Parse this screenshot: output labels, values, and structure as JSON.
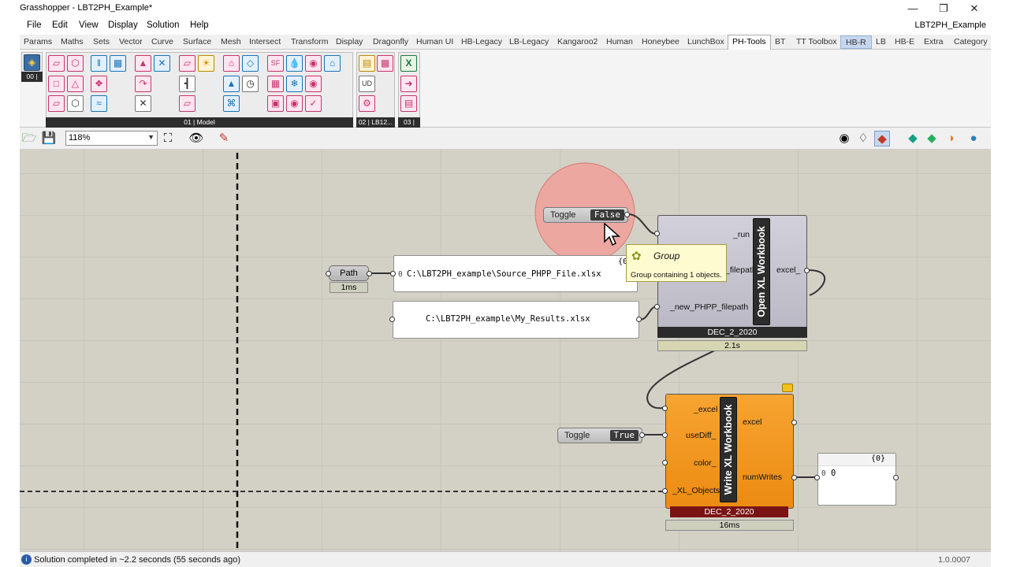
{
  "window": {
    "title": "Grasshopper - LBT2PH_Example*",
    "document_name": "LBT2PH_Example"
  },
  "menu": [
    "File",
    "Edit",
    "View",
    "Display",
    "Solution",
    "Help"
  ],
  "tabs": [
    "Params",
    "Maths",
    "Sets",
    "Vector",
    "Curve",
    "Surface",
    "Mesh",
    "Intersect",
    "Transform",
    "Display",
    "Dragonfly",
    "Human UI",
    "HB-Legacy",
    "LB-Legacy",
    "Kangaroo2",
    "Human",
    "Honeybee",
    "LunchBox",
    "PH-Tools",
    "BT",
    "TT Toolbox",
    "HB-R",
    "LB",
    "HB-E",
    "Extra",
    "Category"
  ],
  "active_tab": "PH-Tools",
  "ribbon": {
    "panel_00": "00 |",
    "panel_01": "01 | Model",
    "panel_02": "02 | LB12...",
    "panel_03": "03 |"
  },
  "canvas_toolbar": {
    "zoom": "118%"
  },
  "nodes": {
    "toggle_false": {
      "label": "Toggle",
      "value": "False"
    },
    "toggle_true": {
      "label": "Toggle",
      "value": "True"
    },
    "path": {
      "label": "Path",
      "time": "1ms"
    },
    "source_panel": {
      "header": "{0}",
      "index": "0",
      "value": "C:\\LBT2PH_example\\Source_PHPP_File.xlsx"
    },
    "results_panel": {
      "value": "C:\\LBT2PH_example\\My_Results.xlsx"
    },
    "open_xl": {
      "title": "Open XL Workbook",
      "inputs": [
        "_run",
        "_filepath",
        "_new_PHPP_filepath"
      ],
      "outputs": [
        "excel_"
      ],
      "version": "DEC_2_2020",
      "time": "2.1s"
    },
    "write_xl": {
      "title": "Write XL Workbook",
      "inputs": [
        "_excel",
        "useDiff_",
        "color_",
        "_XL_Objects"
      ],
      "outputs": [
        "excel",
        "numWrites"
      ],
      "version": "DEC_2_2020",
      "time": "16ms"
    },
    "output_panel": {
      "header": "{0}",
      "index": "0",
      "value": "0"
    }
  },
  "tooltip": {
    "title": "Group",
    "description": "Group containing 1 objects."
  },
  "status": {
    "message": "Solution completed in ~2.2 seconds (55 seconds ago)",
    "version": "1.0.0007"
  },
  "colors": {
    "canvas": "#d3d1c6",
    "open_xl_body": "#c8c6d0",
    "write_xl_body": "#f39a1e",
    "group_circle": "#f0a09a"
  }
}
